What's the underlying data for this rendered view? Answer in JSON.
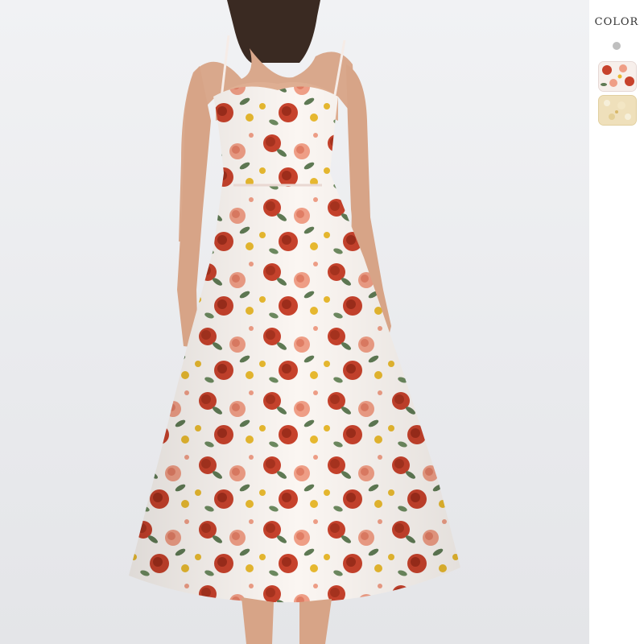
{
  "sidebar": {
    "label": "COLOR",
    "swatches": [
      {
        "name": "floral-white-red",
        "color": "#f7efeb"
      },
      {
        "name": "floral-yellow",
        "color": "#efe0bb"
      }
    ]
  },
  "colors": {
    "dress_base": "#fbf6f2",
    "rose_red": "#c7422c",
    "rose_pink": "#ef9e86",
    "yellow_flower": "#e8b92f",
    "leaf_green": "#5f7a54",
    "skin": "#d9a88c",
    "hair": "#3a2a22"
  }
}
